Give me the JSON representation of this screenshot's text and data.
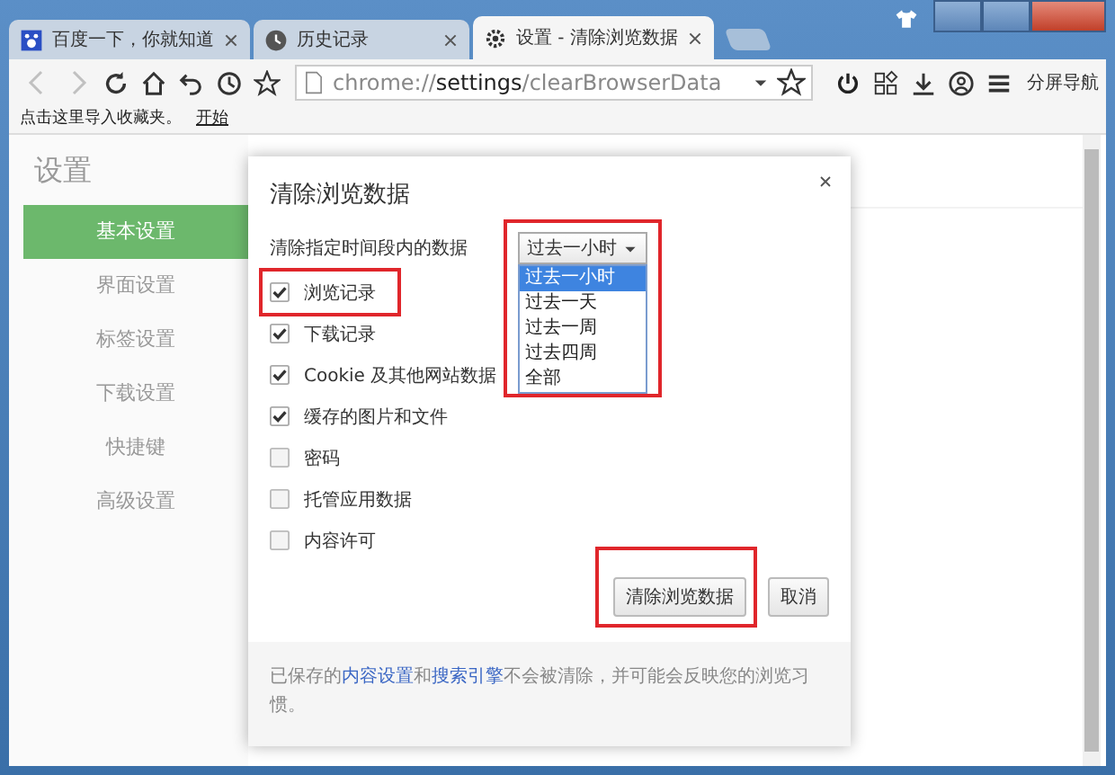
{
  "tabs": [
    {
      "title": "百度一下，你就知道",
      "selected": false
    },
    {
      "title": "历史记录",
      "selected": false
    },
    {
      "title": "设置 - 清除浏览数据",
      "selected": true
    }
  ],
  "toolbar": {
    "back_disabled": true,
    "forward_disabled": true,
    "address": "chrome://**settings**/clearBrowserData",
    "right_label": "分屏导航"
  },
  "bookmarks_bar": {
    "text": "点击这里导入收藏夹。",
    "link": "开始"
  },
  "sidebar": {
    "title": "设置",
    "items": [
      {
        "label": "基本设置",
        "selected": true
      },
      {
        "label": "界面设置",
        "selected": false
      },
      {
        "label": "标签设置",
        "selected": false
      },
      {
        "label": "下载设置",
        "selected": false
      },
      {
        "label": "快捷键",
        "selected": false
      },
      {
        "label": "高级设置",
        "selected": false
      }
    ]
  },
  "dialog": {
    "title": "清除浏览数据",
    "range_label": "清除指定时间段内的数据",
    "range_select": {
      "value": "过去一小时",
      "expanded": true,
      "highlighted": true,
      "options": [
        {
          "label": "过去一小时",
          "selected": true
        },
        {
          "label": "过去一天",
          "selected": false
        },
        {
          "label": "过去一周",
          "selected": false
        },
        {
          "label": "过去四周",
          "selected": false
        },
        {
          "label": "全部",
          "selected": false
        }
      ]
    },
    "items": [
      {
        "label": "浏览记录",
        "checked": true,
        "highlighted": true
      },
      {
        "label": "下载记录",
        "checked": true,
        "highlighted": false
      },
      {
        "label": "Cookie 及其他网站数据",
        "checked": true,
        "highlighted": false
      },
      {
        "label": "缓存的图片和文件",
        "checked": true,
        "highlighted": false
      },
      {
        "label": "密码",
        "checked": false,
        "highlighted": false
      },
      {
        "label": "托管应用数据",
        "checked": false,
        "highlighted": false
      },
      {
        "label": "内容许可",
        "checked": false,
        "highlighted": false
      }
    ],
    "buttons": [
      {
        "label": "清除浏览数据",
        "highlighted": true
      },
      {
        "label": "取消",
        "highlighted": false
      }
    ],
    "footer": [
      {
        "kind": "text",
        "text": "已保存的"
      },
      {
        "kind": "link",
        "text": "内容设置"
      },
      {
        "kind": "text",
        "text": "和"
      },
      {
        "kind": "link",
        "text": "搜索引擎"
      },
      {
        "kind": "text",
        "text": "不会被清除，并可能会反映您的浏览习惯。"
      }
    ]
  }
}
